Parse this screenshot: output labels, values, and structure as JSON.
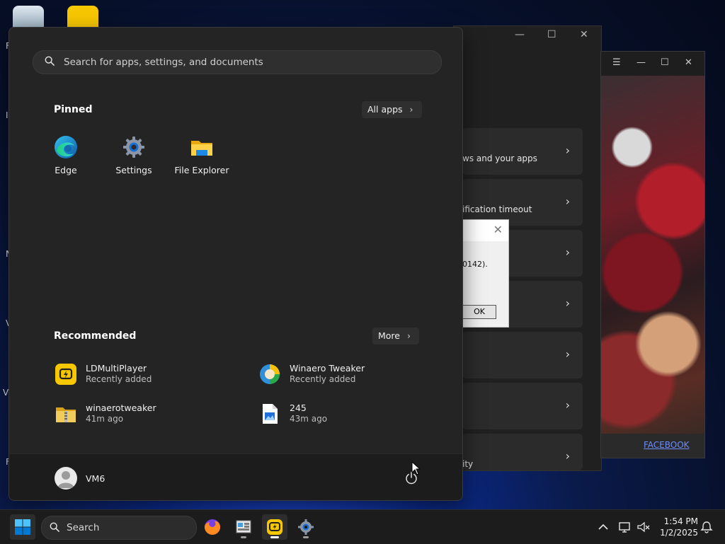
{
  "start_menu": {
    "search_placeholder": "Search for apps, settings, and documents",
    "pinned": {
      "title": "Pinned",
      "all_apps_label": "All apps",
      "apps": [
        {
          "label": "Edge",
          "icon": "edge-icon"
        },
        {
          "label": "Settings",
          "icon": "settings-gear-icon"
        },
        {
          "label": "File Explorer",
          "icon": "folder-icon"
        }
      ]
    },
    "recommended": {
      "title": "Recommended",
      "more_label": "More",
      "items": [
        {
          "name": "LDMultiPlayer",
          "sub": "Recently added",
          "icon": "ldplayer-icon"
        },
        {
          "name": "Winaero Tweaker",
          "sub": "Recently added",
          "icon": "winaero-icon"
        },
        {
          "name": "winaerotweaker",
          "sub": "41m ago",
          "icon": "zip-folder-icon"
        },
        {
          "name": "245",
          "sub": "43m ago",
          "icon": "image-file-icon"
        }
      ]
    },
    "user": {
      "name": "VM6"
    }
  },
  "background_settings": {
    "rows": [
      {
        "text": "ws and your apps"
      },
      {
        "text": "ification timeout"
      },
      {
        "text": ""
      },
      {
        "text": ""
      },
      {
        "text": ""
      },
      {
        "text": ""
      },
      {
        "text": "ity"
      }
    ]
  },
  "dialog": {
    "message": "0142).",
    "ok_label": "OK"
  },
  "art_window": {
    "footer_link": "FACEBOOK"
  },
  "taskbar": {
    "search_label": "Search",
    "time": "1:54 PM",
    "date": "1/2/2025"
  },
  "desktop": {
    "edge_letters": [
      "F",
      "I",
      "N",
      "V",
      "V",
      "F"
    ]
  },
  "colors": {
    "start_bg": "#242424",
    "taskbar_bg": "#1c1c1c",
    "accent_windows": "#0078d4",
    "ldplayer_yellow": "#f7c700",
    "facebook_link": "#6d8dff"
  }
}
